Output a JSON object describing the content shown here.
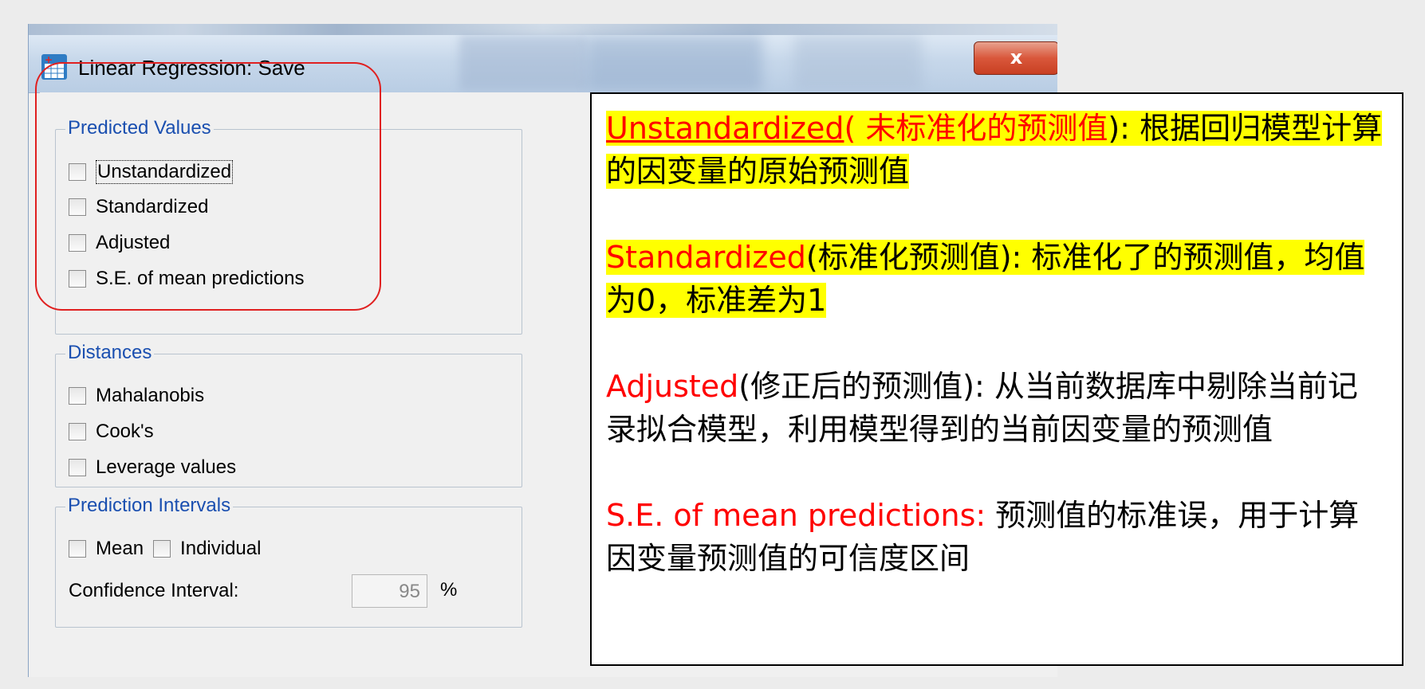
{
  "window": {
    "title": "Linear Regression: Save",
    "close_label": "x"
  },
  "icons": {
    "app": "spss-regression-icon",
    "close": "close-icon"
  },
  "predicted_values": {
    "legend": "Predicted Values",
    "items": [
      {
        "label": "Unstandardized",
        "checked": false,
        "focused": true
      },
      {
        "label": "Standardized",
        "checked": false
      },
      {
        "label": "Adjusted",
        "checked": false
      },
      {
        "label": "S.E. of mean predictions",
        "checked": false
      }
    ]
  },
  "distances": {
    "legend": "Distances",
    "items": [
      {
        "label": "Mahalanobis",
        "checked": false
      },
      {
        "label": "Cook's",
        "checked": false
      },
      {
        "label": "Leverage values",
        "checked": false
      }
    ]
  },
  "prediction_intervals": {
    "legend": "Prediction Intervals",
    "mean_label": "Mean",
    "individual_label": "Individual",
    "ci_label": "Confidence Interval:",
    "ci_value": "95",
    "ci_unit": "%"
  },
  "annotation": {
    "p1_term": "Unstandardized",
    "p1_cn": "( 未标准化的预测值",
    "p1_rest": "): 根据回归模型计算的因变量的原始预测值",
    "p2_term": "Standardized",
    "p2_rest": "(标准化预测值): 标准化了的预测值，均值为0，标准差为1",
    "p3_term": "Adjusted",
    "p3_rest": "(修正后的预测值):  从当前数据库中剔除当前记录拟合模型，利用模型得到的当前因变量的预测值",
    "p4_term": "S.E. of mean predictions: ",
    "p4_rest": " 预测值的标准误，用于计算因变量预测值的可信度区间"
  },
  "colors": {
    "highlight": "#ffff00",
    "term_red": "#ff0000",
    "legend_blue": "#1a4fb0",
    "ellipse": "#e02020"
  }
}
